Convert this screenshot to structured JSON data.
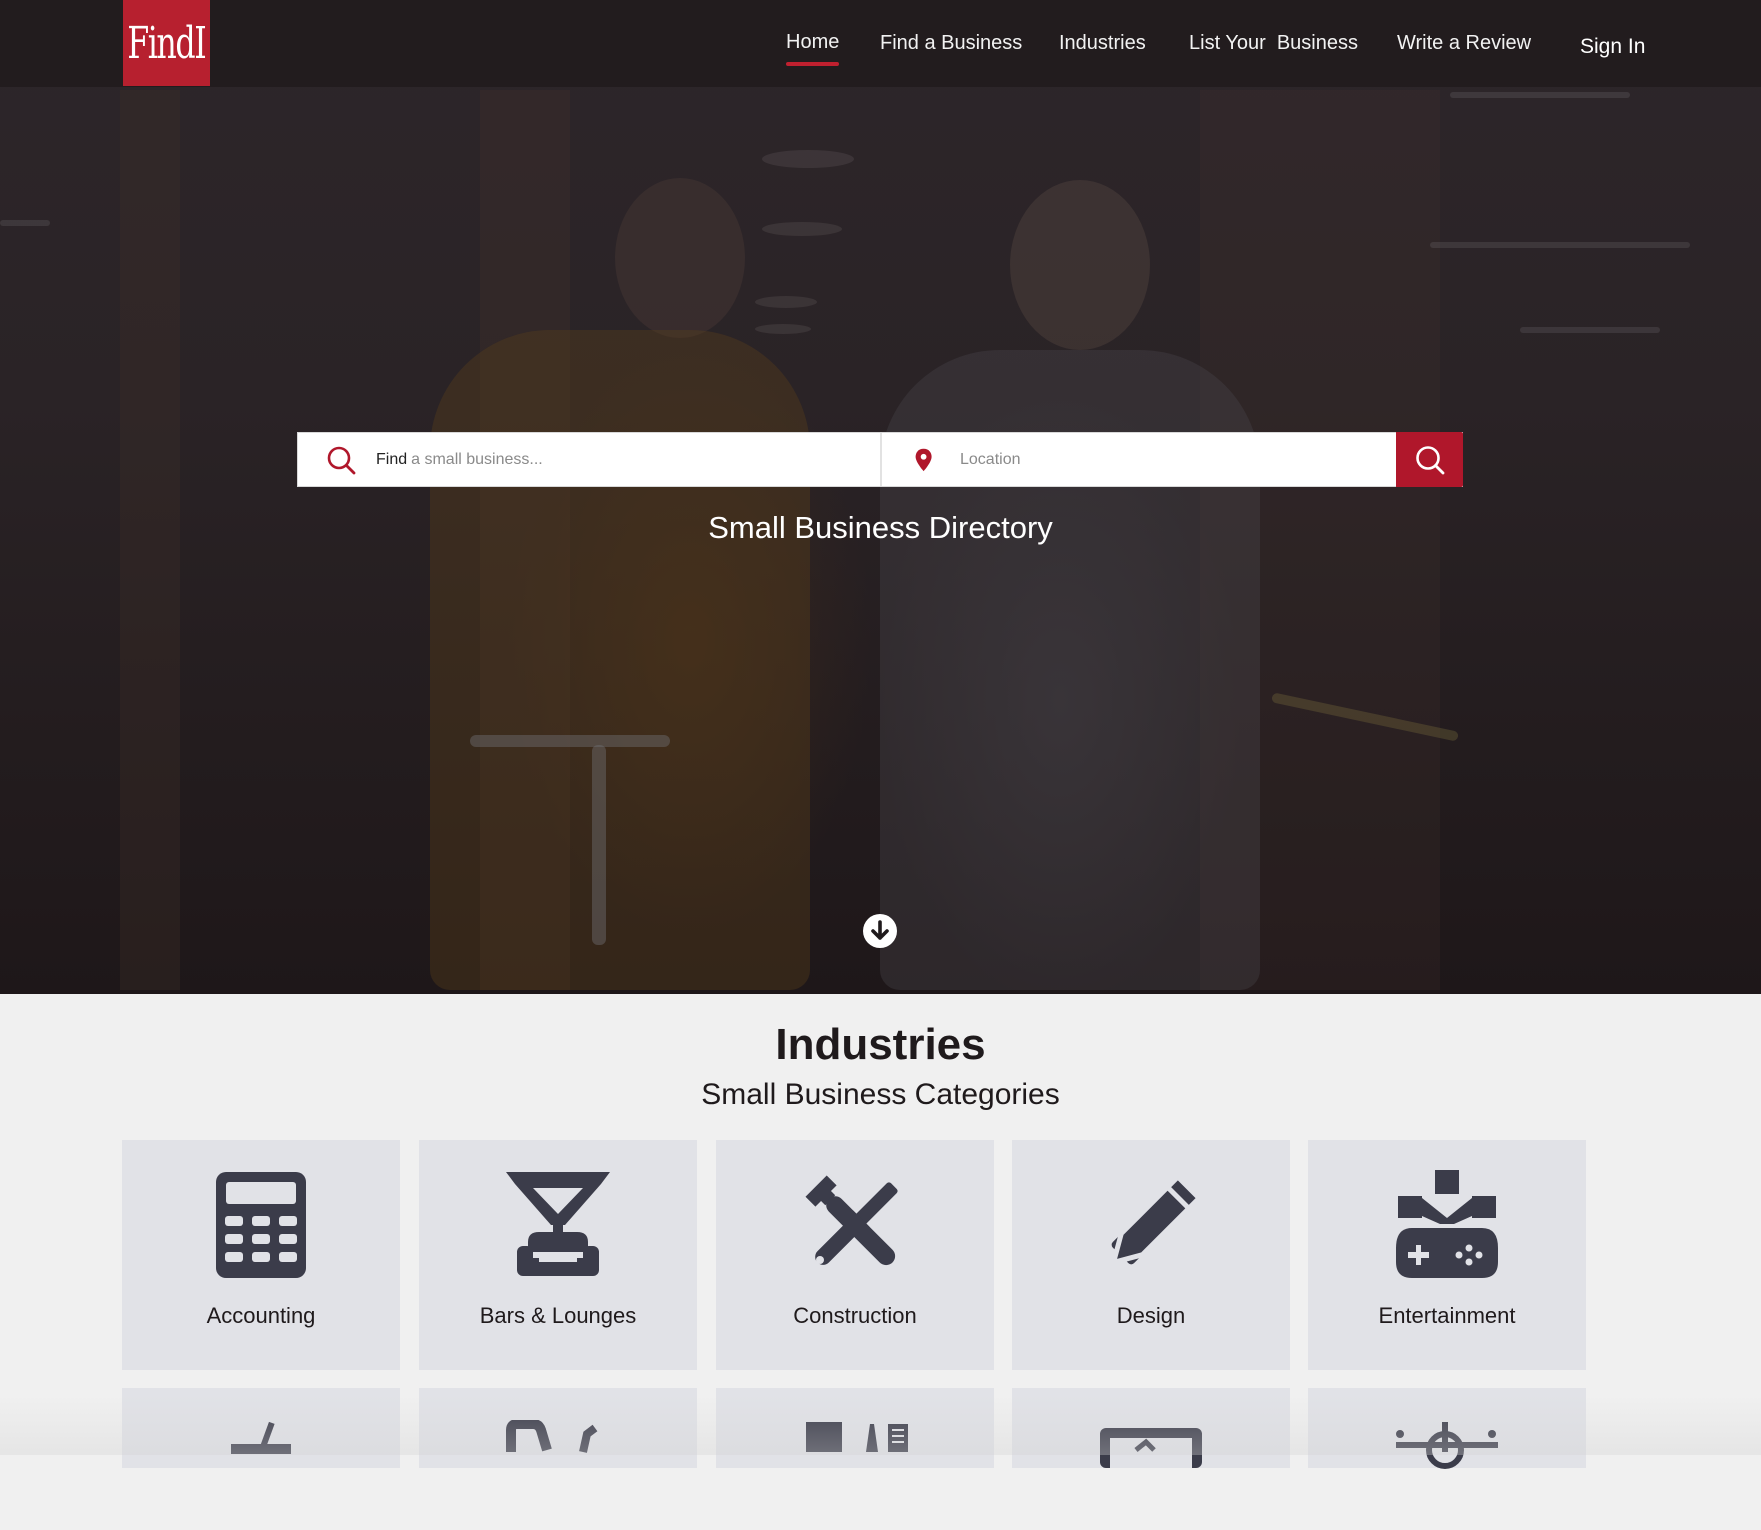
{
  "brand": {
    "logo_text": "FindI",
    "accent_color": "#b0172b"
  },
  "nav": {
    "links": [
      {
        "label": "Home",
        "active": true
      },
      {
        "label": "Find a Business"
      },
      {
        "label": "Industries"
      },
      {
        "label": "List Your  Business"
      },
      {
        "label": "Write a Review"
      }
    ],
    "sign_in": "Sign In"
  },
  "search": {
    "what_label": "Find",
    "what_placeholder": "a small business...",
    "where_placeholder": "Location",
    "icons": {
      "what": "search-icon",
      "where": "map-pin-icon",
      "button": "search-icon"
    }
  },
  "hero": {
    "title": "Small Business Directory",
    "scroll_icon": "arrow-down-circle-icon"
  },
  "industries": {
    "title": "Industries",
    "subtitle": "Small Business Categories",
    "categories": [
      {
        "label": "Accounting",
        "icon": "calculator-icon"
      },
      {
        "label": "Bars & Lounges",
        "icon": "cocktail-lounge-icon"
      },
      {
        "label": "Construction",
        "icon": "tools-icon"
      },
      {
        "label": "Design",
        "icon": "pencil-ruler-icon"
      },
      {
        "label": "Entertainment",
        "icon": "gamepad-icon"
      }
    ],
    "partial_row_icons": [
      "drink-cup-icon",
      "car-icon",
      "industry-icon",
      "monitor-icon",
      "helicopter-icon"
    ]
  }
}
